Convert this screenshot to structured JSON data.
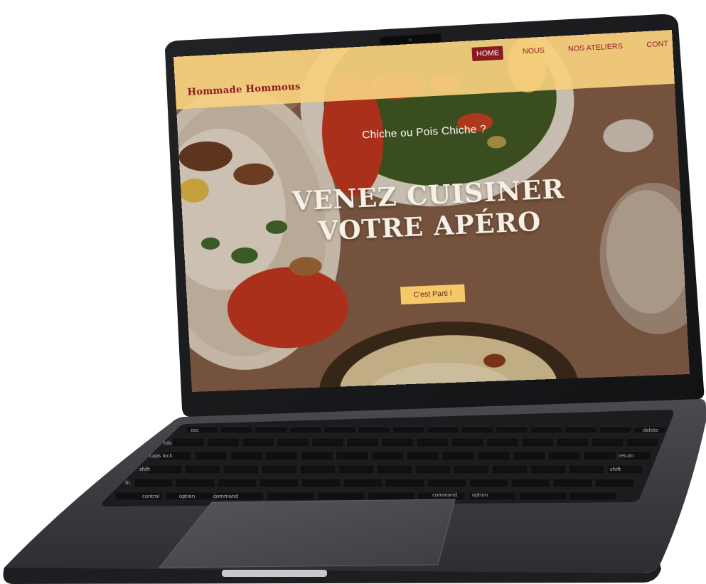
{
  "site": {
    "brand": "Hommade Hommous",
    "nav": [
      {
        "label": "HOME",
        "active": true
      },
      {
        "label": "NOUS",
        "active": false
      },
      {
        "label": "NOS ATELIERS",
        "active": false
      },
      {
        "label": "CONT",
        "active": false
      }
    ],
    "hero": {
      "tagline": "Chiche ou Pois Chiche ?",
      "headline_line1": "Venez cuisiner",
      "headline_line2": "votre apéro",
      "cta_label": "C'est Parti !"
    }
  },
  "keyboard": {
    "keys": [
      "esc",
      "delete",
      "tab",
      "caps lock",
      "return",
      "shift",
      "shift",
      "fn",
      "control",
      "option",
      "command",
      "command",
      "option"
    ]
  },
  "colors": {
    "nav_bg": "#f7d07f",
    "brand_red": "#8b1a1f",
    "cta_bg": "#f7c86a",
    "laptop_body": "#3a3b3f"
  }
}
